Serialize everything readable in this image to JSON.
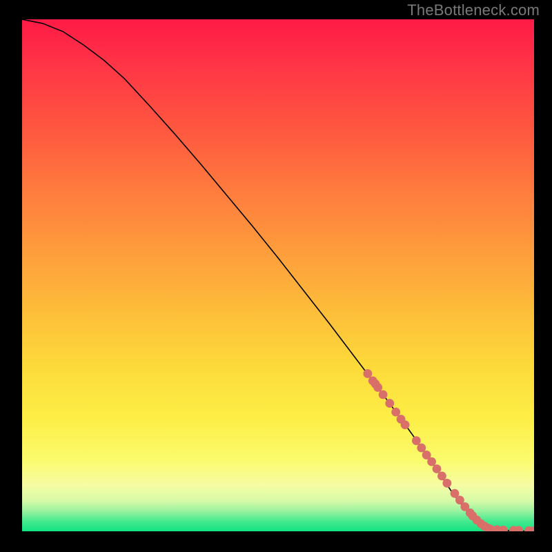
{
  "watermark": "TheBottleneck.com",
  "colors": {
    "dot": "#d87069",
    "line": "#000000",
    "gradient_top": "#ff1a46",
    "gradient_bottom": "#14e483",
    "frame": "#000000"
  },
  "chart_data": {
    "type": "line",
    "title": "",
    "xlabel": "",
    "ylabel": "",
    "xlim": [
      0,
      100
    ],
    "ylim": [
      0,
      100
    ],
    "curve": {
      "x": [
        0,
        4,
        8,
        12,
        16,
        20,
        25,
        30,
        35,
        40,
        45,
        50,
        55,
        60,
        65,
        70,
        75,
        80,
        84,
        86,
        88,
        90,
        92,
        94,
        96,
        98,
        100
      ],
      "y": [
        100,
        99.2,
        97.6,
        95.0,
        92.0,
        88.4,
        83.0,
        77.4,
        71.6,
        65.6,
        59.6,
        53.4,
        47.0,
        40.6,
        34.0,
        27.4,
        20.6,
        13.6,
        7.6,
        5.0,
        3.0,
        1.4,
        0.5,
        0.2,
        0.1,
        0.05,
        0.04
      ]
    },
    "dots": {
      "x": [
        67.5,
        68.5,
        69.0,
        69.5,
        70.5,
        71.8,
        73.0,
        74.0,
        74.8,
        77.0,
        78.0,
        79.0,
        80.0,
        81.0,
        82.0,
        83.0,
        84.5,
        85.5,
        86.5,
        87.5,
        88.0,
        88.8,
        89.6,
        90.3,
        91.0,
        91.5,
        92.8,
        94.0,
        96.0,
        97.0,
        99.0,
        100.0
      ],
      "y": [
        30.8,
        29.4,
        28.8,
        28.1,
        26.7,
        25.0,
        23.3,
        21.9,
        20.8,
        17.7,
        16.3,
        14.9,
        13.6,
        12.2,
        10.8,
        9.4,
        7.4,
        6.1,
        4.8,
        3.6,
        3.0,
        2.2,
        1.5,
        1.0,
        0.6,
        0.4,
        0.3,
        0.25,
        0.2,
        0.18,
        0.12,
        0.1
      ]
    }
  }
}
